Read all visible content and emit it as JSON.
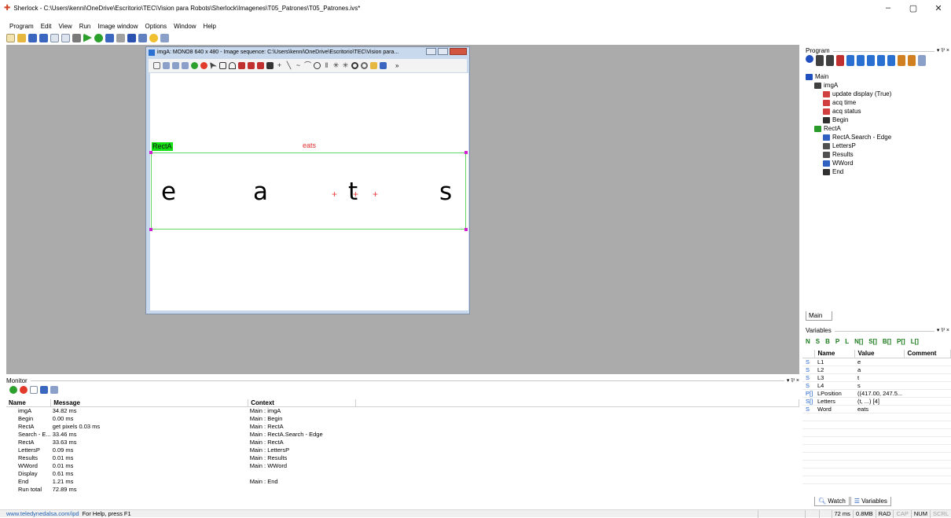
{
  "window": {
    "title": "Sherlock - C:\\Users\\kenni\\OneDrive\\Escritorio\\TEC\\Vision para Robots\\Sherlock\\Imagenes\\T05_Patrones\\T05_Patrones.ivs*",
    "minimize": "–",
    "maximize": "▢",
    "close": "✕"
  },
  "menu": [
    "Program",
    "Edit",
    "View",
    "Run",
    "Image window",
    "Options",
    "Window",
    "Help"
  ],
  "image_window": {
    "title": "imgA: MONO8 640 x 480 - Image sequence: C:\\Users\\kenni\\OneDrive\\Escritorio\\TEC\\Vision para...",
    "roi_label": "RectA",
    "word_label": "eats",
    "letters": [
      "e",
      "a",
      "t",
      "s"
    ]
  },
  "monitor": {
    "title": "Monitor",
    "columns": [
      "Name",
      "Message",
      "Context"
    ],
    "rows": [
      [
        "imgA",
        "34.82 ms",
        "Main : imgA"
      ],
      [
        "Begin",
        "0.00 ms",
        "Main : Begin"
      ],
      [
        "RectA",
        "get pixels 0.03 ms",
        "Main : RectA"
      ],
      [
        "Search - E...",
        "33.46 ms",
        "Main : RectA.Search - Edge"
      ],
      [
        "RectA",
        "33.63 ms",
        "Main : RectA"
      ],
      [
        "LettersP",
        "0.09 ms",
        "Main : LettersP"
      ],
      [
        "Results",
        "0.01 ms",
        "Main : Results"
      ],
      [
        "WWord",
        "0.01 ms",
        "Main : WWord"
      ],
      [
        "Display",
        "0.61 ms",
        ""
      ],
      [
        "End",
        "1.21 ms",
        "Main : End"
      ],
      [
        "Run total",
        "72.89 ms",
        ""
      ]
    ]
  },
  "program": {
    "title": "Program",
    "pin": "▾ ⅌ ×",
    "tree": [
      {
        "label": "Main",
        "indent": 0,
        "icon": "#2050c0"
      },
      {
        "label": "imgA",
        "indent": 1,
        "icon": "#404040"
      },
      {
        "label": "update display (True)",
        "indent": 2,
        "icon": "#d04040"
      },
      {
        "label": "acq time",
        "indent": 2,
        "icon": "#d04040"
      },
      {
        "label": "acq status",
        "indent": 2,
        "icon": "#d04040"
      },
      {
        "label": "Begin",
        "indent": 2,
        "icon": "#303030"
      },
      {
        "label": "RectA",
        "indent": 1,
        "icon": "#2a9a2a"
      },
      {
        "label": "RectA.Search - Edge",
        "indent": 2,
        "icon": "#3060c0"
      },
      {
        "label": "LettersP",
        "indent": 2,
        "icon": "#505050"
      },
      {
        "label": "Results",
        "indent": 2,
        "icon": "#505050"
      },
      {
        "label": "WWord",
        "indent": 2,
        "icon": "#3060c0"
      },
      {
        "label": "End",
        "indent": 2,
        "icon": "#303030"
      }
    ],
    "tab": "Main"
  },
  "variables": {
    "title": "Variables",
    "toolbar": [
      "N",
      "S",
      "B",
      "P",
      "L",
      "N[]",
      "S[]",
      "B[]",
      "P[]",
      "L[]"
    ],
    "columns": [
      "Name",
      "Value",
      "Comment"
    ],
    "rows": [
      [
        "S",
        "L1",
        "e"
      ],
      [
        "S",
        "L2",
        "a"
      ],
      [
        "S",
        "L3",
        "t"
      ],
      [
        "S",
        "L4",
        "s"
      ],
      [
        "P[]",
        "LPosition",
        "((417.00, 247.5..."
      ],
      [
        "S[]",
        "Letters",
        "(t, ...) [4]"
      ],
      [
        "S",
        "Word",
        "eats"
      ]
    ],
    "tabs": [
      "Watch",
      "Variables"
    ]
  },
  "status": {
    "url": "www.teledynedalsa.com/ipd",
    "help": "For Help, press F1",
    "cells": [
      "72 ms",
      "0.8MB",
      "RAD",
      "CAP",
      "NUM",
      "SCRL"
    ]
  },
  "colors": {
    "workspace": "#ababab",
    "roi": "#64d864",
    "accent": "#e63c3c"
  }
}
